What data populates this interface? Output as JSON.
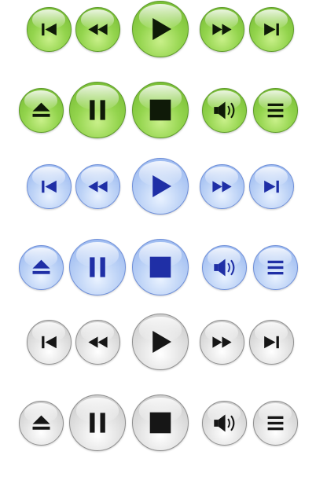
{
  "rows": [
    {
      "theme": "green",
      "color": "#7fc23c",
      "buttons": [
        {
          "name": "skip-back-button",
          "icon": "skip-back-icon"
        },
        {
          "name": "rewind-button",
          "icon": "rewind-icon"
        },
        {
          "name": "play-button",
          "icon": "play-icon"
        },
        {
          "name": "fast-forward-button",
          "icon": "fast-forward-icon"
        },
        {
          "name": "skip-forward-button",
          "icon": "skip-forward-icon"
        }
      ]
    },
    {
      "theme": "green",
      "color": "#7fc23c",
      "buttons": [
        {
          "name": "eject-button",
          "icon": "eject-icon"
        },
        {
          "name": "pause-button",
          "icon": "pause-icon"
        },
        {
          "name": "stop-button",
          "icon": "stop-icon"
        },
        {
          "name": "volume-button",
          "icon": "volume-icon"
        },
        {
          "name": "menu-button",
          "icon": "menu-icon"
        }
      ]
    },
    {
      "theme": "blue",
      "color": "#a9c4f3",
      "buttons": [
        {
          "name": "skip-back-button",
          "icon": "skip-back-icon"
        },
        {
          "name": "rewind-button",
          "icon": "rewind-icon"
        },
        {
          "name": "play-button",
          "icon": "play-icon"
        },
        {
          "name": "fast-forward-button",
          "icon": "fast-forward-icon"
        },
        {
          "name": "skip-forward-button",
          "icon": "skip-forward-icon"
        }
      ]
    },
    {
      "theme": "blue",
      "color": "#a9c4f3",
      "buttons": [
        {
          "name": "eject-button",
          "icon": "eject-icon"
        },
        {
          "name": "pause-button",
          "icon": "pause-icon"
        },
        {
          "name": "stop-button",
          "icon": "stop-icon"
        },
        {
          "name": "volume-button",
          "icon": "volume-icon"
        },
        {
          "name": "menu-button",
          "icon": "menu-icon"
        }
      ]
    },
    {
      "theme": "gray",
      "color": "#d6d6d6",
      "buttons": [
        {
          "name": "skip-back-button",
          "icon": "skip-back-icon"
        },
        {
          "name": "rewind-button",
          "icon": "rewind-icon"
        },
        {
          "name": "play-button",
          "icon": "play-icon"
        },
        {
          "name": "fast-forward-button",
          "icon": "fast-forward-icon"
        },
        {
          "name": "skip-forward-button",
          "icon": "skip-forward-icon"
        }
      ]
    },
    {
      "theme": "gray",
      "color": "#d6d6d6",
      "buttons": [
        {
          "name": "eject-button",
          "icon": "eject-icon"
        },
        {
          "name": "pause-button",
          "icon": "pause-icon"
        },
        {
          "name": "stop-button",
          "icon": "stop-icon"
        },
        {
          "name": "volume-button",
          "icon": "volume-icon"
        },
        {
          "name": "menu-button",
          "icon": "menu-icon"
        }
      ]
    }
  ]
}
